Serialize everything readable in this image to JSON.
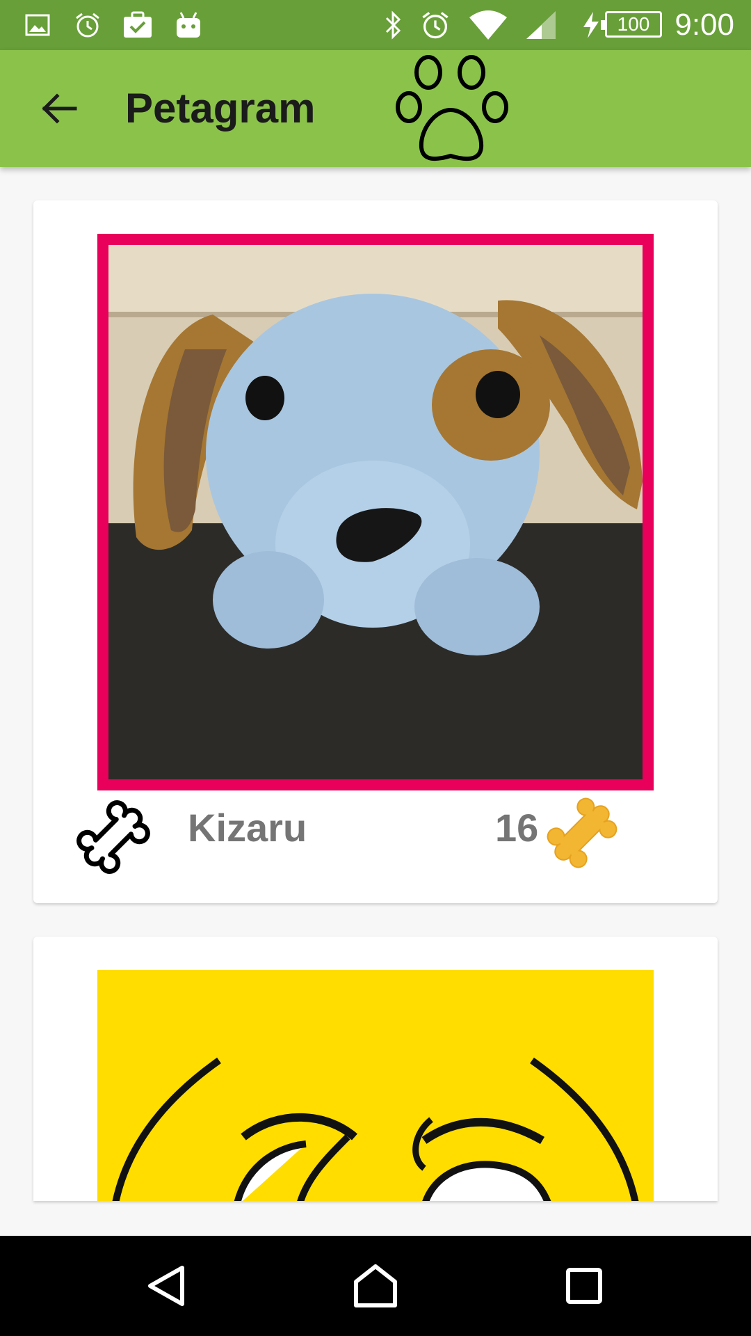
{
  "status_bar": {
    "time": "9:00",
    "battery": "100",
    "left_icons": [
      "image-icon",
      "alarm-icon",
      "task-icon",
      "android-icon"
    ],
    "right_icons": [
      "bluetooth-icon",
      "alarm-icon",
      "wifi-icon",
      "signal-icon",
      "charging-icon",
      "battery-icon"
    ]
  },
  "app_bar": {
    "title": "Petagram",
    "back_icon": "arrow-back-icon",
    "logo_icon": "paw-icon",
    "color": "#8bc34a",
    "status_color": "#689f38"
  },
  "pets": [
    {
      "name": "Kizaru",
      "likes": "16",
      "frame_color": "#e8005a",
      "like_icon": "bone-outline-icon",
      "rating_icon": "bone-gold-icon"
    },
    {
      "image_bg": "#ffdd00"
    }
  ],
  "nav_bar": {
    "back_icon": "nav-back-icon",
    "home_icon": "nav-home-icon",
    "recents_icon": "nav-recents-icon"
  }
}
